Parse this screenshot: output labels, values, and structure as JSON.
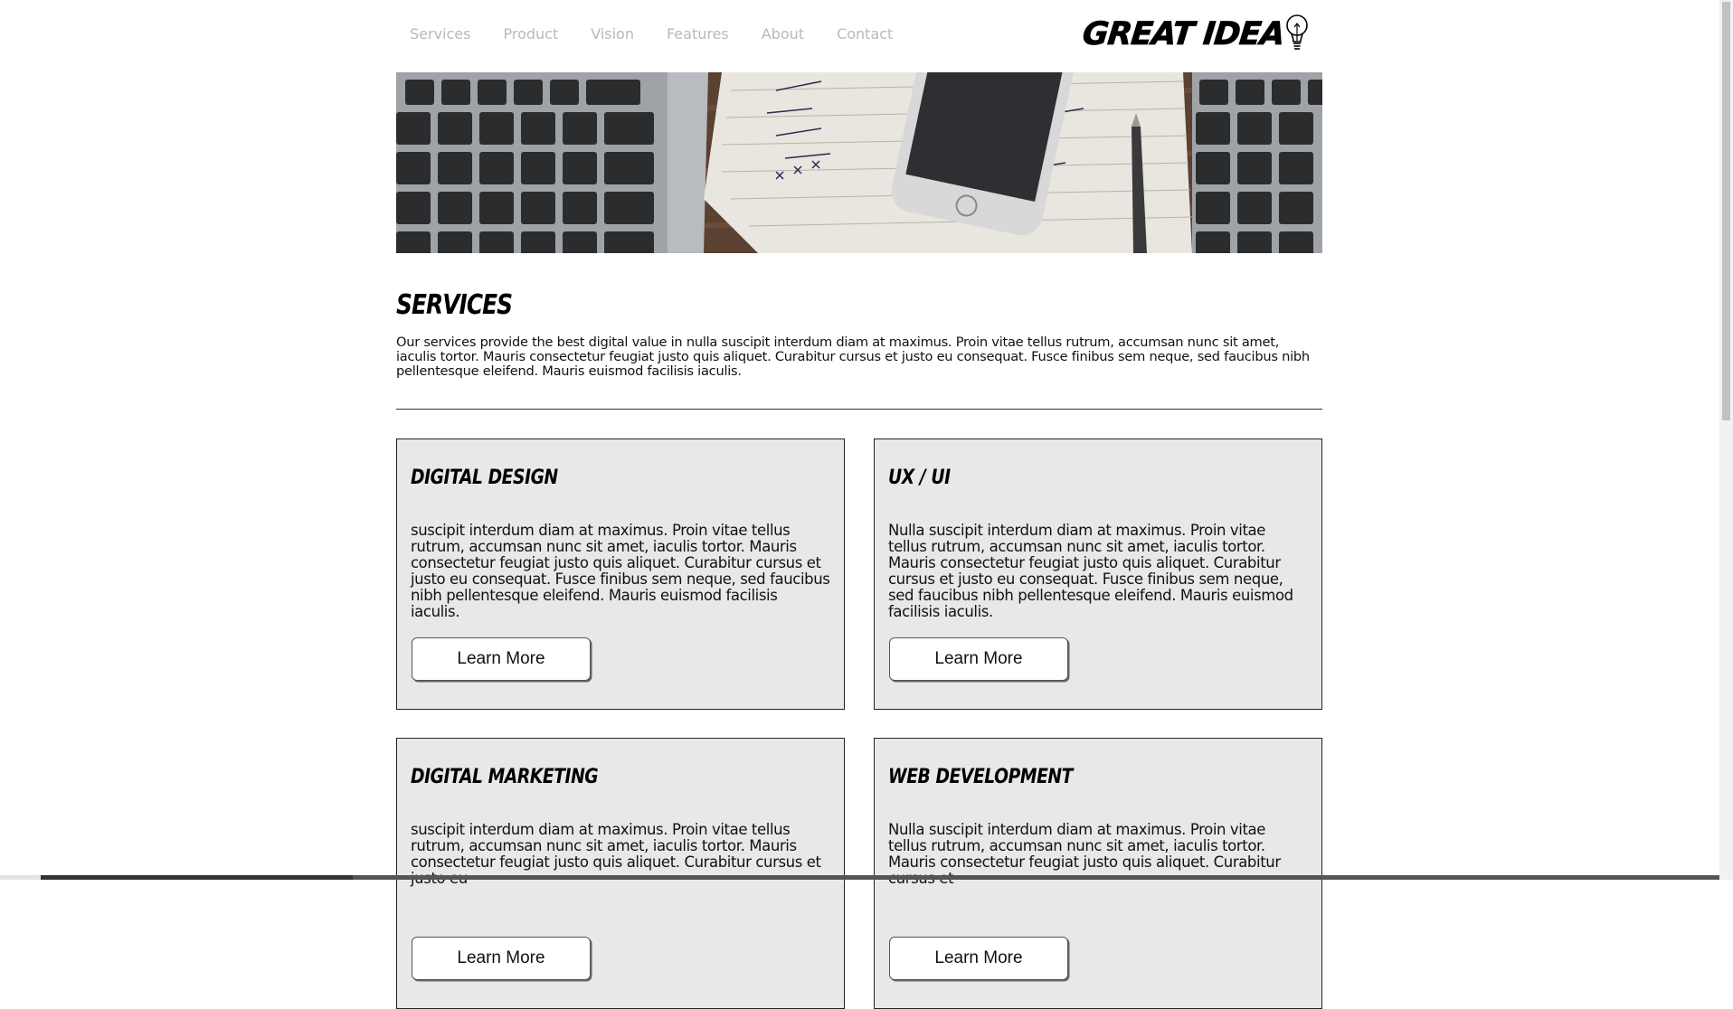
{
  "nav": {
    "links": [
      "Services",
      "Product",
      "Vision",
      "Features",
      "About",
      "Contact"
    ]
  },
  "logo": {
    "text": "GREAT IDEA",
    "icon": "lightbulb-icon"
  },
  "hero": {
    "image": "laptop-phone-notebook-photo"
  },
  "services": {
    "title": "SERVICES",
    "intro": "Our services provide the best digital value in nulla suscipit interdum diam at maximus. Proin vitae tellus rutrum, accumsan nunc sit amet, iaculis tortor. Mauris consectetur feugiat justo quis aliquet. Curabitur cursus et justo eu consequat. Fusce finibus sem neque, sed faucibus nibh pellentesque eleifend. Mauris euismod facilisis iaculis."
  },
  "cards": [
    {
      "title": "DIGITAL DESIGN",
      "body": "suscipit interdum diam at maximus. Proin vitae tellus rutrum, accumsan nunc sit amet, iaculis tortor. Mauris consectetur feugiat justo quis aliquet. Curabitur cursus et justo eu consequat. Fusce finibus sem neque, sed faucibus nibh pellentesque eleifend. Mauris euismod facilisis iaculis.",
      "button": "Learn More"
    },
    {
      "title": "UX / UI",
      "body": "Nulla suscipit interdum diam at maximus. Proin vitae tellus rutrum, accumsan nunc sit amet, iaculis tortor. Mauris consectetur feugiat justo quis aliquet. Curabitur cursus et justo eu consequat. Fusce finibus sem neque, sed faucibus nibh pellentesque eleifend. Mauris euismod facilisis iaculis.",
      "button": "Learn More"
    },
    {
      "title": "DIGITAL MARKETING",
      "body": "suscipit interdum diam at maximus. Proin vitae tellus rutrum, accumsan nunc sit amet, iaculis tortor. Mauris consectetur feugiat justo quis aliquet. Curabitur cursus et justo eu",
      "button": "Learn More"
    },
    {
      "title": "WEB DEVELOPMENT",
      "body": "Nulla suscipit interdum diam at maximus. Proin vitae tellus rutrum, accumsan nunc sit amet, iaculis tortor. Mauris consectetur feugiat justo quis aliquet. Curabitur cursus et",
      "button": "Learn More"
    }
  ]
}
